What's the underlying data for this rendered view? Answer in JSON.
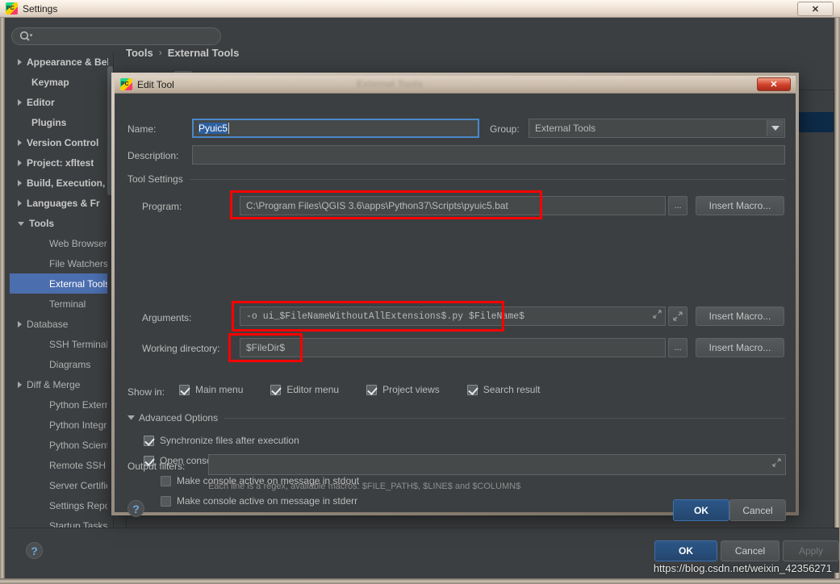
{
  "desktop": {
    "blurred_titlebar_present": true
  },
  "settings_window": {
    "title": "Settings",
    "app_icon": "pycharm-icon",
    "close_label": "✕",
    "search": {
      "value": "",
      "placeholder": ""
    },
    "sidebar": {
      "items": [
        {
          "label": "Appearance & Behavior",
          "level": "top",
          "arrow": "right",
          "selected": false
        },
        {
          "label": "Keymap",
          "level": "top",
          "arrow": "none",
          "selected": false
        },
        {
          "label": "Editor",
          "level": "top",
          "arrow": "right",
          "selected": false
        },
        {
          "label": "Plugins",
          "level": "top",
          "arrow": "none",
          "selected": false
        },
        {
          "label": "Version Control",
          "level": "top",
          "arrow": "right",
          "selected": false
        },
        {
          "label": "Project: xfltest",
          "level": "top",
          "arrow": "right",
          "selected": false
        },
        {
          "label": "Build, Execution,",
          "level": "top",
          "arrow": "right",
          "selected": false
        },
        {
          "label": "Languages & Fr",
          "level": "top",
          "arrow": "right",
          "selected": false
        },
        {
          "label": "Tools",
          "level": "top",
          "arrow": "down",
          "selected": false
        },
        {
          "label": "Web Browser",
          "level": "child",
          "arrow": "none",
          "selected": false
        },
        {
          "label": "File Watchers",
          "level": "child",
          "arrow": "none",
          "selected": false
        },
        {
          "label": "External Tools",
          "level": "child",
          "arrow": "none",
          "selected": true
        },
        {
          "label": "Terminal",
          "level": "child",
          "arrow": "none",
          "selected": false
        },
        {
          "label": "Database",
          "level": "child",
          "arrow": "right",
          "selected": false
        },
        {
          "label": "SSH Terminal",
          "level": "child",
          "arrow": "none",
          "selected": false
        },
        {
          "label": "Diagrams",
          "level": "child",
          "arrow": "none",
          "selected": false
        },
        {
          "label": "Diff & Merge",
          "level": "child",
          "arrow": "right",
          "selected": false
        },
        {
          "label": "Python Extern",
          "level": "child",
          "arrow": "none",
          "selected": false
        },
        {
          "label": "Python Integr",
          "level": "child",
          "arrow": "none",
          "selected": false
        },
        {
          "label": "Python Scienti",
          "level": "child",
          "arrow": "none",
          "selected": false
        },
        {
          "label": "Remote SSH E",
          "level": "child",
          "arrow": "none",
          "selected": false
        },
        {
          "label": "Server Certific",
          "level": "child",
          "arrow": "none",
          "selected": false
        },
        {
          "label": "Settings Repo",
          "level": "child",
          "arrow": "none",
          "selected": false
        },
        {
          "label": "Startup Tasks",
          "level": "child",
          "arrow": "none",
          "selected": false
        }
      ]
    },
    "breadcrumb": {
      "parent": "Tools",
      "separator": "›",
      "current": "External Tools"
    },
    "toolbar": [
      {
        "name": "add-button",
        "glyph": "+",
        "color": "#5aa85a",
        "active": false
      },
      {
        "name": "remove-button",
        "glyph": "−",
        "color": "#d96c5f",
        "active": false
      },
      {
        "name": "edit-button",
        "glyph": "pencil",
        "color": "#8ec07c",
        "active": true
      },
      {
        "name": "move-up-button",
        "glyph": "↑",
        "color": "#5c9ed6",
        "active": false
      },
      {
        "name": "move-down-button",
        "glyph": "↓",
        "color": "#5c9ed6",
        "active": false
      },
      {
        "name": "copy-button",
        "glyph": "copy",
        "color": "#9ab3c6",
        "active": false
      }
    ],
    "tools_list": [
      {
        "label": "",
        "selected": true
      }
    ],
    "footer": {
      "help_label": "?",
      "ok_label": "OK",
      "cancel_label": "Cancel",
      "apply_label": "Apply"
    },
    "watermark": "https://blog.csdn.net/weixin_42356271"
  },
  "edit_tool_dialog": {
    "title": "Edit Tool",
    "app_icon": "pycharm-icon",
    "background_ghost_title": "External Tools",
    "close_label": "✕",
    "fields": {
      "name": {
        "label": "Name:",
        "value": "Pyuic5",
        "selected": true
      },
      "description": {
        "label": "Description:",
        "value": ""
      },
      "group": {
        "label": "Group:",
        "value": "External Tools"
      }
    },
    "tool_settings": {
      "group_title": "Tool Settings",
      "program": {
        "label": "Program:",
        "value": "C:\\Program Files\\QGIS 3.6\\apps\\Python37\\Scripts\\pyuic5.bat",
        "browse_label": "...",
        "macro_label": "Insert Macro...",
        "highlighted": true
      },
      "arguments": {
        "label": "Arguments:",
        "value": "-o ui_$FileNameWithoutAllExtensions$.py $FileName$",
        "expand_label": "⤢",
        "macro_label": "Insert Macro...",
        "highlighted": true
      },
      "working_directory": {
        "label": "Working directory:",
        "value": "$FileDir$",
        "browse_label": "...",
        "macro_label": "Insert Macro...",
        "highlighted": true
      }
    },
    "show_in": {
      "label": "Show in:",
      "options": [
        {
          "label": "Main menu",
          "checked": true
        },
        {
          "label": "Editor menu",
          "checked": true
        },
        {
          "label": "Project views",
          "checked": true
        },
        {
          "label": "Search result",
          "checked": true
        }
      ]
    },
    "advanced_options": {
      "title": "Advanced Options",
      "expanded": true,
      "options": [
        {
          "label": "Synchronize files after execution",
          "checked": true,
          "indent": 0
        },
        {
          "label": "Open console for tool output",
          "checked": true,
          "indent": 0
        },
        {
          "label": "Make console active on message in stdout",
          "checked": false,
          "indent": 1
        },
        {
          "label": "Make console active on message in stderr",
          "checked": false,
          "indent": 1
        }
      ],
      "output_filters": {
        "label": "Output filters:",
        "value": "",
        "expand_label": "⤢",
        "hint": "Each line is a regex, available macros: $FILE_PATH$, $LINE$ and $COLUMN$"
      }
    },
    "footer": {
      "help_label": "?",
      "ok_label": "OK",
      "cancel_label": "Cancel"
    }
  },
  "colors": {
    "accent_blue": "#4b6eaf",
    "highlight_red": "#ff0000",
    "panel_bg": "#3c3f41",
    "field_bg": "#45494a",
    "selection_blue": "#2d5f9e"
  }
}
